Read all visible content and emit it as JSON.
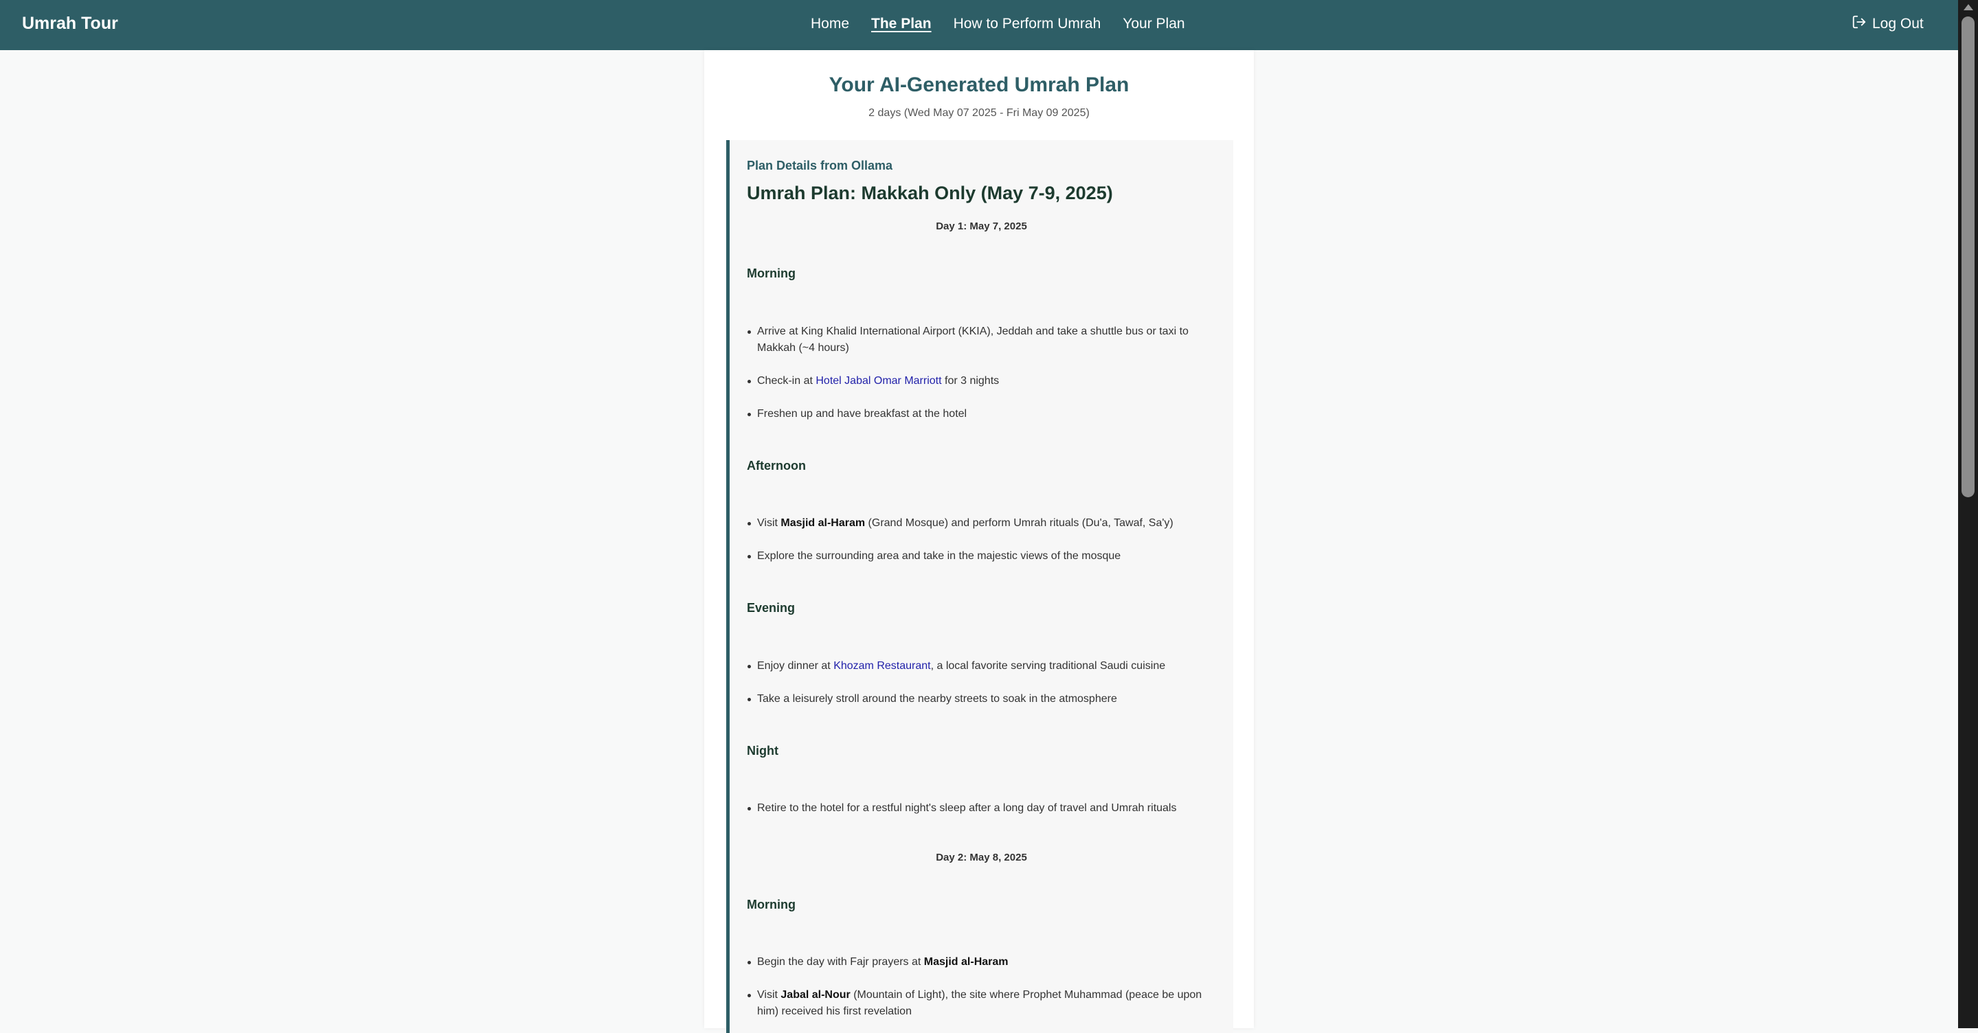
{
  "nav": {
    "brand": "Umrah Tour",
    "links": [
      "Home",
      "The Plan",
      "How to Perform Umrah",
      "Your Plan"
    ],
    "logout": "Log Out"
  },
  "page": {
    "title": "Your AI-Generated Umrah Plan",
    "subtitle": "2 days (Wed May 07 2025 - Fri May 09 2025)"
  },
  "plan": {
    "source_label": "Plan Details from Ollama",
    "heading": "Umrah Plan: Makkah Only (May 7-9, 2025)",
    "day1": {
      "title": "Day 1: May 7, 2025",
      "morning": "Morning",
      "m1": "Arrive at King Khalid International Airport (KKIA), Jeddah and take a shuttle bus or taxi to Makkah (~4 hours)",
      "m2_pre": "Check-in at ",
      "m2_link": "Hotel Jabal Omar Marriott",
      "m2_post": " for 3 nights",
      "m3": "Freshen up and have breakfast at the hotel",
      "afternoon": "Afternoon",
      "a1_pre": "Visit ",
      "a1_bold": "Masjid al-Haram",
      "a1_post": " (Grand Mosque) and perform Umrah rituals (Du'a, Tawaf, Sa'y)",
      "a2": "Explore the surrounding area and take in the majestic views of the mosque",
      "evening": "Evening",
      "e1_pre": "Enjoy dinner at ",
      "e1_link": "Khozam Restaurant",
      "e1_post": ", a local favorite serving traditional Saudi cuisine",
      "e2": "Take a leisurely stroll around the nearby streets to soak in the atmosphere",
      "night": "Night",
      "n1": "Retire to the hotel for a restful night's sleep after a long day of travel and Umrah rituals"
    },
    "day2": {
      "title": "Day 2: May 8, 2025",
      "morning": "Morning",
      "m1_pre": "Begin the day with Fajr prayers at ",
      "m1_bold": "Masjid al-Haram",
      "m2_pre": "Visit ",
      "m2_bold": "Jabal al-Nour",
      "m2_post": " (Mountain of Light), the site where Prophet Muhammad (peace be upon him) received his first revelation"
    }
  }
}
